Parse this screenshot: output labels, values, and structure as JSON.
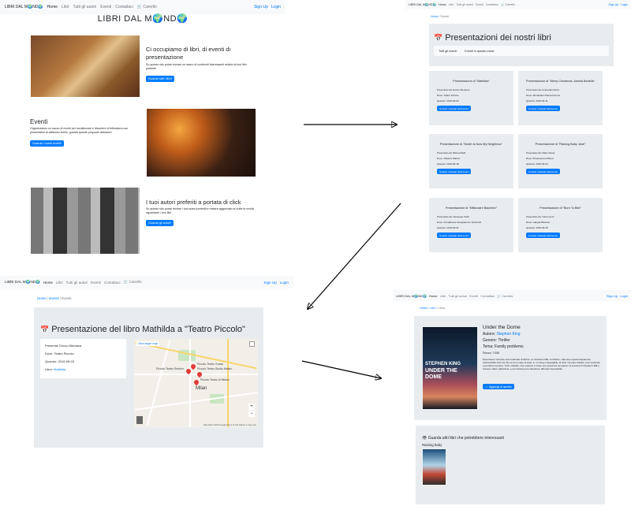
{
  "nav": {
    "brand": "LIBRI DAL M🌍ND🌍",
    "links": [
      "Home",
      "Libri",
      "Tutti gli autori",
      "Eventi",
      "Contattaci"
    ],
    "cart": "🛒 Carrello",
    "signup": "Sign Up",
    "login": "Login"
  },
  "home": {
    "title": "LIBRI DAL M🌍ND🌍",
    "s1": {
      "heading": "Ci occupiamo di libri, di eventi di presentazione",
      "text": "Su questo sito potrai trovare un sacco di contenuti interessanti relativi ai tuoi libri preferiti!",
      "button": "Guarda tutti i libri!"
    },
    "s2": {
      "heading": "Eventi",
      "text": "Organizziamo un sacco di eventi per socializzare e discutere di letteratura con presentatori di altissimo livello, guarda quante proposte abbiamo!",
      "button": "Guarda i nostri eventi!"
    },
    "s3": {
      "heading": "I tuoi autori preferiti a portata di click",
      "text": "Su questo sito potrai trovare i tuoi autori preferiti e restare aggiornato su tutte le novità riguardanti i loro libri",
      "button": "Guarda gli autori!"
    }
  },
  "events": {
    "breadcrumb": [
      "Home",
      "Eventi"
    ],
    "calendar_icon": "📅",
    "title": "Presentazioni dei nostri libri",
    "tabs": [
      "Tutti gli eventi",
      "Eventi in questo mese"
    ],
    "cards": [
      {
        "title": "Presentazione di \"Mathilda\"",
        "presenter": "Presentato da: Enrico Mentana",
        "where": "Dove: Teatro Piccolo",
        "when": "Quando: 2019-09-03"
      },
      {
        "title": "Presentazione di \"Merry Christmas, Amelia Bedelia\"",
        "presenter": "Presentato da: Antonella Clerici",
        "where": "Dove: Mondadori Piazza Duomo",
        "when": "Quando: 2019-09-11"
      },
      {
        "title": "Presentazione di \"Death is Now My Neighbour\"",
        "presenter": "Presentato da: Bianca Balti",
        "where": "Dove: Palazzo Marino",
        "when": "Quando: 2019-09-18"
      },
      {
        "title": "Presentazione di \"Raising Baby Jane\"",
        "presenter": "Presentato da: Mara Venier",
        "where": "Dove: Pinacoteca di Brera",
        "when": "Quando: 2019-09-24"
      },
      {
        "title": "Presentazione di \"Millionaire Bachelor\"",
        "presenter": "Presentato da: Giuseppe Verdi",
        "where": "Dove: Fondazione Giangiacomo Feltrinelli",
        "when": "Quando: 2019-09-21"
      },
      {
        "title": "Presentazione di \"Born To Bite\"",
        "presenter": "Presentato da: Carlo Conti",
        "where": "Dove: Hangar Bicocca",
        "when": "Quando: 2019-09-25"
      }
    ],
    "card_button": "Guarda i dettagli dell'evento"
  },
  "event_detail": {
    "breadcrumb": [
      "Home",
      "Eventi",
      "Eventi"
    ],
    "calendar_icon": "📅",
    "title": "Presentazione del libro Mathilda a \"Teatro Piccolo\"",
    "presenter": "Presenta: Enrico Mentana",
    "where": "Dove: Teatro Piccolo",
    "when": "Quando: 2019-09-03",
    "book_label": "Libro:",
    "book_link": "Mathilda",
    "map": {
      "city": "Milan",
      "view_larger": "View larger map",
      "places": [
        "Piccolo Teatro Grassi",
        "Piccolo Teatro Studio Melato",
        "Piccolo Teatro Strehler",
        "Piccolo Teatro di Milano"
      ],
      "attribution": "Map data ©2019 Google  Terms of Use  Report a map error"
    }
  },
  "book": {
    "breadcrumb": [
      "Home",
      "Libri",
      "Libro"
    ],
    "title": "Under the Dome",
    "author_label": "Autore:",
    "author": "Stephen King",
    "genre": "Genere: Thriller",
    "theme": "Tema: Family problems",
    "price": "Prezzo: 7.00€",
    "description": "Descrizione: Durante una mattinata d'ottobre, su Chester's Mill, nel Maine, cala una cupola trasparente, inaccessibile tutto ciò che si trova sotto di essa: in un luogo inspiegabile, la città, il proprio fratello, ed è costretta a prendere il potere. Tutti i cittadini, che credono vi fosse una presenza nel paese, la sovrana di Chester's Mill e l'essere nativo dell'anima, e nel contempo la situazione affronta l'impossibile.",
    "cover_author": "STEPHEN KING",
    "cover_title": "UNDER THE DOME",
    "add_to_cart": "🛒 Aggiungi al carrello",
    "also_heading": "👁 Guarda altri libri che potrebbero interessarti",
    "also_book": "Raising baby"
  }
}
